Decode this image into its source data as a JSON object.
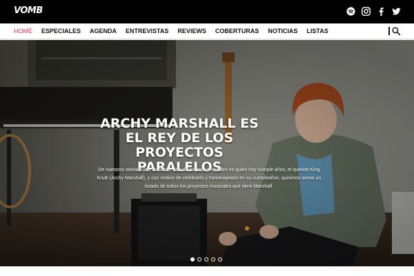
{
  "brand": {
    "logo_text": "VOMB"
  },
  "social": [
    {
      "name": "spotify-icon"
    },
    {
      "name": "instagram-icon"
    },
    {
      "name": "facebook-icon"
    },
    {
      "name": "twitter-icon"
    }
  ],
  "nav": {
    "items": [
      {
        "label": "HOME",
        "active": true
      },
      {
        "label": "ESPECIALES",
        "active": false
      },
      {
        "label": "AGENDA",
        "active": false
      },
      {
        "label": "ENTREVISTAS",
        "active": false
      },
      {
        "label": "REVIEWS",
        "active": false
      },
      {
        "label": "COBERTURAS",
        "active": false
      },
      {
        "label": "NOTICIAS",
        "active": false
      },
      {
        "label": "LISTAS",
        "active": false
      }
    ],
    "search_icon": "search-icon"
  },
  "hero": {
    "title": "ARCHY MARSHALL ES EL REY DE LOS PROYECTOS PARALELOS",
    "description": "De nuestros workaholics favoritos, uno de los más versátiles es quien hoy cumple años, el querido King Krule (Archy Marshall), y con motivo de celebrarlo y homenajearlo en su cumpleaños, quisimos armar un listado de todos los proyectos musicales que tiene Marshall.",
    "slides_total": 5,
    "active_slide": 1
  },
  "colors": {
    "accent": "#d6334f",
    "topbar": "#000000",
    "nav_text": "#111111"
  }
}
